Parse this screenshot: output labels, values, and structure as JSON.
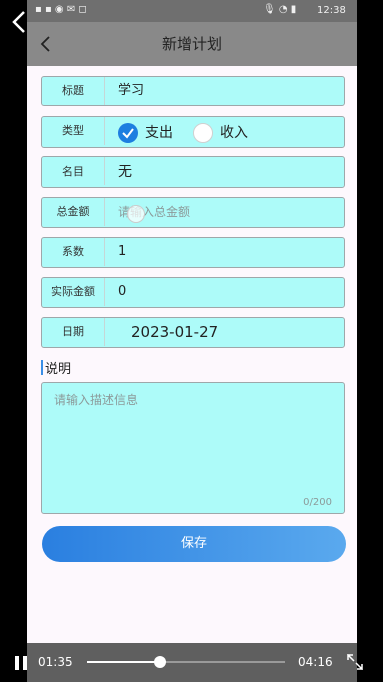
{
  "status": {
    "time": "12:38"
  },
  "header": {
    "title": "新增计划"
  },
  "form": {
    "title": {
      "label": "标题",
      "value": "学习"
    },
    "type": {
      "label": "类型",
      "option_expense": "支出",
      "option_income": "收入",
      "selected": "支出"
    },
    "name": {
      "label": "名目",
      "value": "无"
    },
    "total": {
      "label": "总金额",
      "placeholder": "请输入总金额"
    },
    "coefficient": {
      "label": "系数",
      "value": "1"
    },
    "actual": {
      "label": "实际金额",
      "value": "0"
    },
    "date": {
      "label": "日期",
      "value": "2023-01-27"
    }
  },
  "description": {
    "heading": "说明",
    "placeholder": "请输入描述信息",
    "counter": "0/200"
  },
  "save_button": {
    "label": "保存"
  },
  "video": {
    "elapsed": "01:35",
    "duration": "04:16",
    "progress": 0.37
  },
  "colors": {
    "field_bg": "#adfbf9",
    "radio_selected": "#1d7ee0",
    "button_start": "#2a7fe0",
    "button_end": "#5aa9ee"
  }
}
